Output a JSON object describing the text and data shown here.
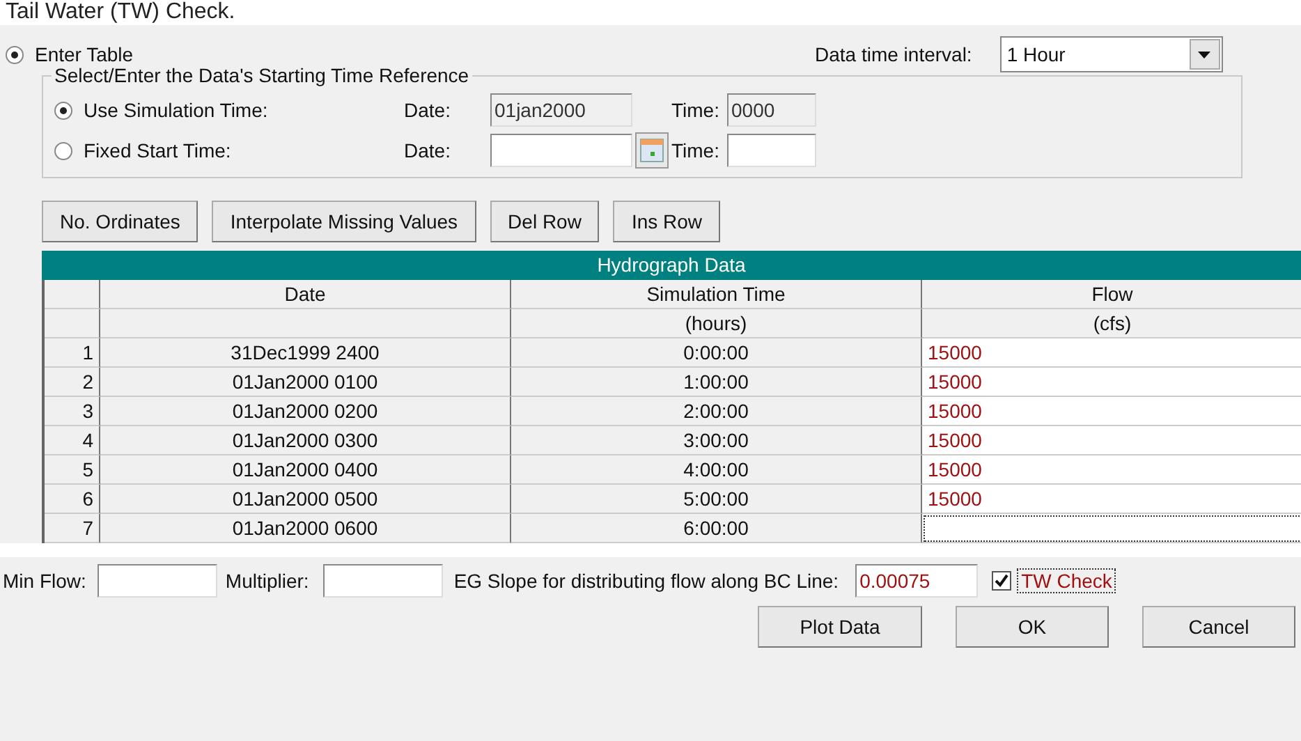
{
  "heading": "Tail Water (TW) Check.",
  "mode": {
    "label": "Enter Table",
    "selected": true
  },
  "interval": {
    "label": "Data time interval:",
    "value": "1 Hour"
  },
  "time_reference": {
    "title": "Select/Enter the Data's Starting Time Reference",
    "options": [
      {
        "label": "Use Simulation Time:",
        "selected": true,
        "date_label": "Date:",
        "date": "01jan2000",
        "time_label": "Time:",
        "time": "0000",
        "disabled": true,
        "calendar": false
      },
      {
        "label": "Fixed Start Time:",
        "selected": false,
        "date_label": "Date:",
        "time_label": "Time:",
        "disabled": false,
        "calendar": true
      }
    ]
  },
  "buttons": [
    "No. Ordinates",
    "Interpolate Missing Values",
    "Del Row",
    "Ins Row"
  ],
  "table": {
    "title": "Hydrograph Data",
    "columns": [
      {
        "name": "Date"
      },
      {
        "name": "Simulation Time",
        "unit": "(hours)"
      },
      {
        "name": "Flow",
        "unit": "(cfs)"
      }
    ],
    "rows": [
      {
        "number": "1",
        "date": "31Dec1999 2400",
        "time": "0:00:00",
        "flow": "15000",
        "focused": false
      },
      {
        "number": "2",
        "date": "01Jan2000 0100",
        "time": "1:00:00",
        "flow": "15000",
        "focused": false
      },
      {
        "number": "3",
        "date": "01Jan2000 0200",
        "time": "2:00:00",
        "flow": "15000",
        "focused": false
      },
      {
        "number": "4",
        "date": "01Jan2000 0300",
        "time": "3:00:00",
        "flow": "15000",
        "focused": false
      },
      {
        "number": "5",
        "date": "01Jan2000 0400",
        "time": "4:00:00",
        "flow": "15000",
        "focused": false
      },
      {
        "number": "6",
        "date": "01Jan2000 0500",
        "time": "5:00:00",
        "flow": "15000",
        "focused": false
      },
      {
        "number": "7",
        "date": "01Jan2000 0600",
        "time": "6:00:00",
        "focused": true
      }
    ]
  },
  "footer": {
    "min_flow_label": "Min Flow:",
    "multiplier_label": "Multiplier:",
    "eg_slope_label": "EG Slope for distributing flow along BC Line:",
    "eg_slope": "0.00075",
    "tw_check": {
      "label": "TW Check",
      "checked": true
    }
  },
  "actions": [
    "Plot Data",
    "OK",
    "Cancel"
  ]
}
